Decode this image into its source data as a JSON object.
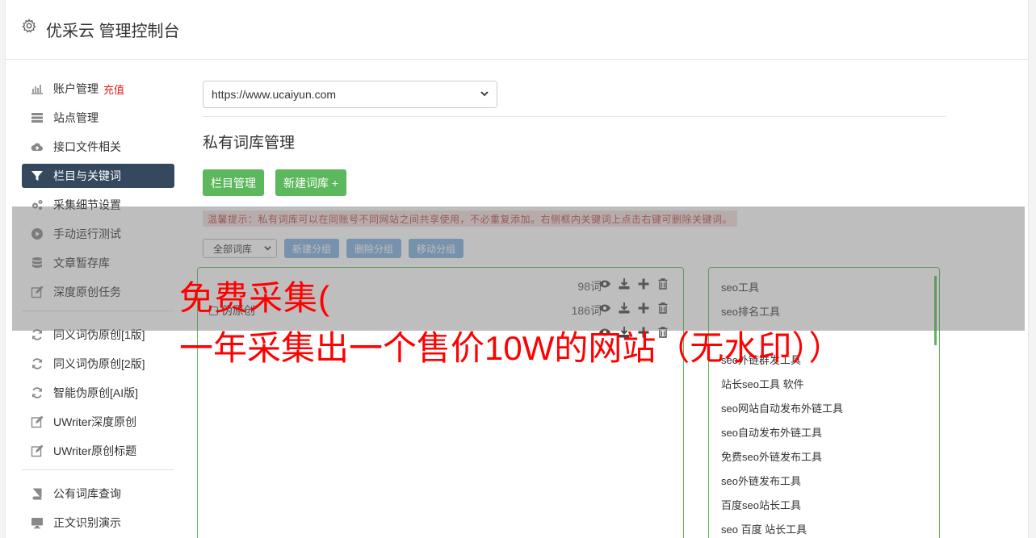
{
  "app": {
    "title": "优采云 管理控制台"
  },
  "sidebar": {
    "items": [
      {
        "label": "账户管理",
        "extra": "充值",
        "icon": "bar-chart-icon"
      },
      {
        "label": "站点管理",
        "icon": "server-icon"
      },
      {
        "label": "接口文件相关",
        "icon": "cloud-upload-icon"
      },
      {
        "label": "栏目与关键词",
        "icon": "filter-icon",
        "active": true
      },
      {
        "label": "采集细节设置",
        "icon": "gears-icon"
      },
      {
        "label": "手动运行测试",
        "icon": "play-circle-icon"
      },
      {
        "label": "文章暂存库",
        "icon": "database-icon"
      },
      {
        "label": "深度原创任务",
        "icon": "edit-icon"
      }
    ],
    "group2": [
      {
        "label": "同义词伪原创[1版]",
        "icon": "refresh-icon"
      },
      {
        "label": "同义词伪原创[2版]",
        "icon": "refresh-icon"
      },
      {
        "label": "智能伪原创[AI版]",
        "icon": "refresh-icon"
      },
      {
        "label": "UWriter深度原创",
        "icon": "edit-icon"
      },
      {
        "label": "UWriter原创标题",
        "icon": "edit-icon"
      }
    ],
    "group3": [
      {
        "label": "公有词库查询",
        "icon": "book-icon"
      },
      {
        "label": "正文识别演示",
        "icon": "monitor-icon"
      }
    ]
  },
  "main": {
    "site_select": "https://www.ucaiyun.com",
    "section_title": "私有词库管理",
    "btn_columns": "栏目管理",
    "btn_new_lib": "新建词库 +",
    "tip": "温馨提示：私有词库可以在同账号不同网站之间共享使用，不必重复添加。右侧框内关键词上点击右键可删除关键词。",
    "filter_select": "全部词库",
    "btn_new_group": "新建分组",
    "btn_delete_group": "删除分组",
    "btn_move_group": "移动分组"
  },
  "libraries": [
    {
      "name": "",
      "count": "98词"
    },
    {
      "name": "伪原创",
      "count": "186词"
    },
    {
      "name": "",
      "count": ""
    }
  ],
  "keywords": [
    "seo工具",
    "seo排名工具",
    "",
    "seo外链群发工具",
    "站长seo工具 软件",
    "seo网站自动发布外链工具",
    "seo自动发布外链工具",
    "免费seo外链发布工具",
    "seo外链发布工具",
    "百度seo站长工具",
    "seo 百度 站长工具"
  ],
  "watermark": {
    "line1": "免费采集(",
    "line2": "一年采集出一个售价10W的网站（无水印））"
  },
  "colors": {
    "accent_green": "#5cb85c",
    "active_nav": "#34495e",
    "watermark_red": "#ff0000"
  }
}
